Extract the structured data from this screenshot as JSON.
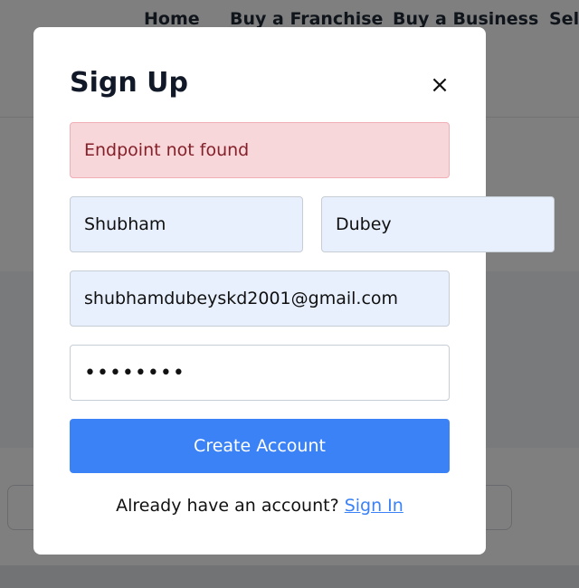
{
  "nav": {
    "items": [
      "Home",
      "Buy a Franchise",
      "Buy a Business",
      "Sell"
    ]
  },
  "modal": {
    "title": "Sign Up",
    "close_icon": "×",
    "alert": "Endpoint not found",
    "first_name": "Shubham",
    "last_name": "Dubey",
    "email": "shubhamdubeyskd2001@gmail.com",
    "password": "••••••••",
    "submit_label": "Create Account",
    "footer_text": "Already have an account? ",
    "footer_link": "Sign In"
  },
  "colors": {
    "primary": "#3b82f6",
    "alert_bg": "#f8d7da",
    "alert_text": "#842029",
    "autofill_bg": "#e8f0fe"
  }
}
